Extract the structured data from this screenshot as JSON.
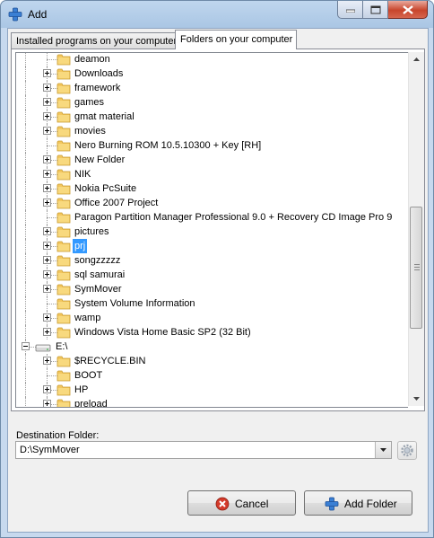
{
  "window": {
    "title": "Add"
  },
  "tabs": [
    {
      "label": "Installed programs on your computer",
      "active": false
    },
    {
      "label": "Folders on your computer",
      "active": true
    }
  ],
  "tree": {
    "items": [
      {
        "label": "deamon",
        "level": 1,
        "expander": "none",
        "icon": "folder-icon"
      },
      {
        "label": "Downloads",
        "level": 1,
        "expander": "plus",
        "icon": "folder-icon"
      },
      {
        "label": "framework",
        "level": 1,
        "expander": "plus",
        "icon": "folder-icon"
      },
      {
        "label": "games",
        "level": 1,
        "expander": "plus",
        "icon": "folder-icon"
      },
      {
        "label": "gmat material",
        "level": 1,
        "expander": "plus",
        "icon": "folder-icon"
      },
      {
        "label": "movies",
        "level": 1,
        "expander": "plus",
        "icon": "folder-icon"
      },
      {
        "label": "Nero Burning ROM 10.5.10300 + Key [RH]",
        "level": 1,
        "expander": "none",
        "icon": "folder-icon"
      },
      {
        "label": "New Folder",
        "level": 1,
        "expander": "plus",
        "icon": "folder-icon"
      },
      {
        "label": "NIK",
        "level": 1,
        "expander": "plus",
        "icon": "folder-icon"
      },
      {
        "label": "Nokia PcSuite",
        "level": 1,
        "expander": "plus",
        "icon": "folder-icon"
      },
      {
        "label": "Office 2007 Project",
        "level": 1,
        "expander": "plus",
        "icon": "folder-icon"
      },
      {
        "label": "Paragon Partition Manager Professional 9.0 + Recovery CD Image Pro 9",
        "level": 1,
        "expander": "none",
        "icon": "folder-icon"
      },
      {
        "label": "pictures",
        "level": 1,
        "expander": "plus",
        "icon": "folder-icon"
      },
      {
        "label": "prj",
        "level": 1,
        "expander": "plus",
        "icon": "folder-icon",
        "selected": true
      },
      {
        "label": "songzzzzz",
        "level": 1,
        "expander": "plus",
        "icon": "folder-icon"
      },
      {
        "label": "sql samurai",
        "level": 1,
        "expander": "plus",
        "icon": "folder-icon"
      },
      {
        "label": "SymMover",
        "level": 1,
        "expander": "plus",
        "icon": "folder-icon"
      },
      {
        "label": "System Volume Information",
        "level": 1,
        "expander": "none",
        "icon": "folder-icon"
      },
      {
        "label": "wamp",
        "level": 1,
        "expander": "plus",
        "icon": "folder-icon"
      },
      {
        "label": "Windows Vista Home Basic SP2 (32 Bit)",
        "level": 1,
        "expander": "plus",
        "icon": "folder-icon"
      },
      {
        "label": "E:\\",
        "level": 0,
        "expander": "minus",
        "icon": "drive-icon"
      },
      {
        "label": "$RECYCLE.BIN",
        "level": 1,
        "expander": "plus",
        "icon": "folder-icon"
      },
      {
        "label": "BOOT",
        "level": 1,
        "expander": "none",
        "icon": "folder-icon"
      },
      {
        "label": "HP",
        "level": 1,
        "expander": "plus",
        "icon": "folder-icon"
      },
      {
        "label": "preload",
        "level": 1,
        "expander": "plus",
        "icon": "folder-icon"
      }
    ]
  },
  "destination": {
    "label": "Destination Folder:",
    "value": "D:\\SymMover"
  },
  "buttons": {
    "cancel": "Cancel",
    "add_folder": "Add Folder"
  },
  "colors": {
    "selection": "#3399ff",
    "folder": "#f3c75f",
    "cancel_icon": "#d43a2a",
    "plus_icon": "#3a7fd4"
  }
}
